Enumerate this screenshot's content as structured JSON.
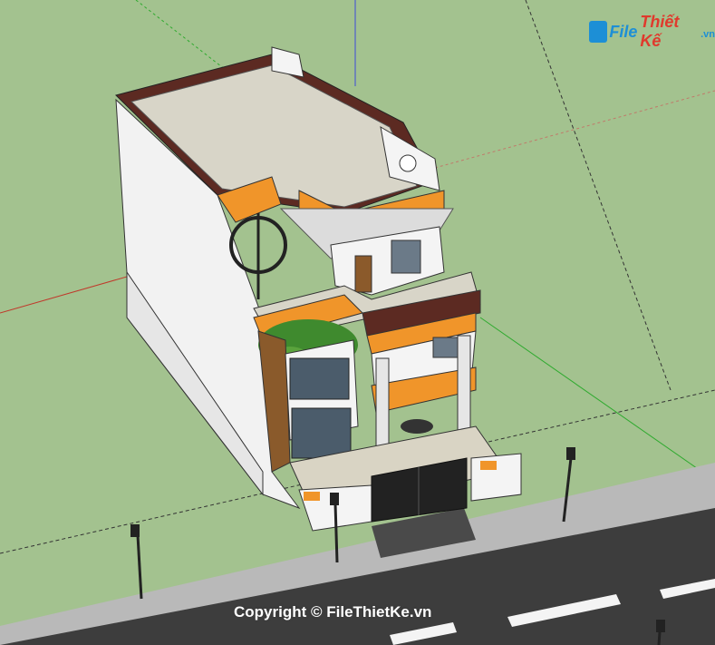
{
  "watermark": {
    "logo_file": "File",
    "logo_thietke": "Thiết Kế",
    "logo_vn": ".vn",
    "copyright": "Copyright © FileThietKe.vn"
  },
  "colors": {
    "ground": "#a3c28f",
    "road": "#3d3d3d",
    "sidewalk": "#b9b9b9",
    "accent_orange": "#f0952a",
    "band_brown": "#5c2a22",
    "wall_white": "#f4f4f4",
    "roof_tile": "#d8d5c8"
  }
}
